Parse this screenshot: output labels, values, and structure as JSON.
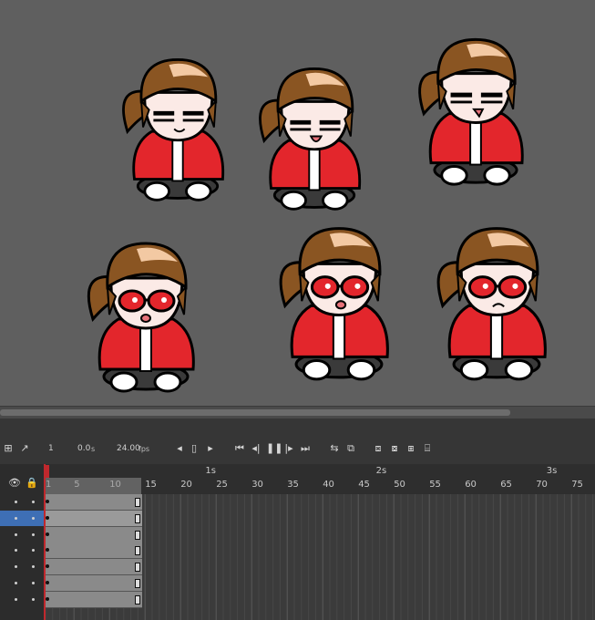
{
  "timeline": {
    "frame_value": "1",
    "time_value": "0.0",
    "time_unit": "s",
    "fps_value": "24.00",
    "fps_unit": "fps",
    "seconds": [
      "1s",
      "2s",
      "3s"
    ],
    "ticks": [
      "1",
      "5",
      "10",
      "15",
      "20",
      "25",
      "30",
      "35",
      "40",
      "45",
      "50",
      "55",
      "60",
      "65",
      "70",
      "75"
    ],
    "layers": [
      {
        "selected": false
      },
      {
        "selected": true
      },
      {
        "selected": false
      },
      {
        "selected": false
      },
      {
        "selected": false
      },
      {
        "selected": false
      },
      {
        "selected": false
      }
    ]
  },
  "colors": {
    "stage": "#5f5f5f",
    "timeline_bg": "#2f2f2f",
    "selected_layer": "#3e6fb5",
    "playhead": "#c0282d",
    "hair": "#8a5522",
    "jacket": "#e3262c",
    "glasses": "#e3262c"
  },
  "icons": {
    "eye": "eye-icon",
    "lock": "lock-icon",
    "play": "play-icon"
  }
}
